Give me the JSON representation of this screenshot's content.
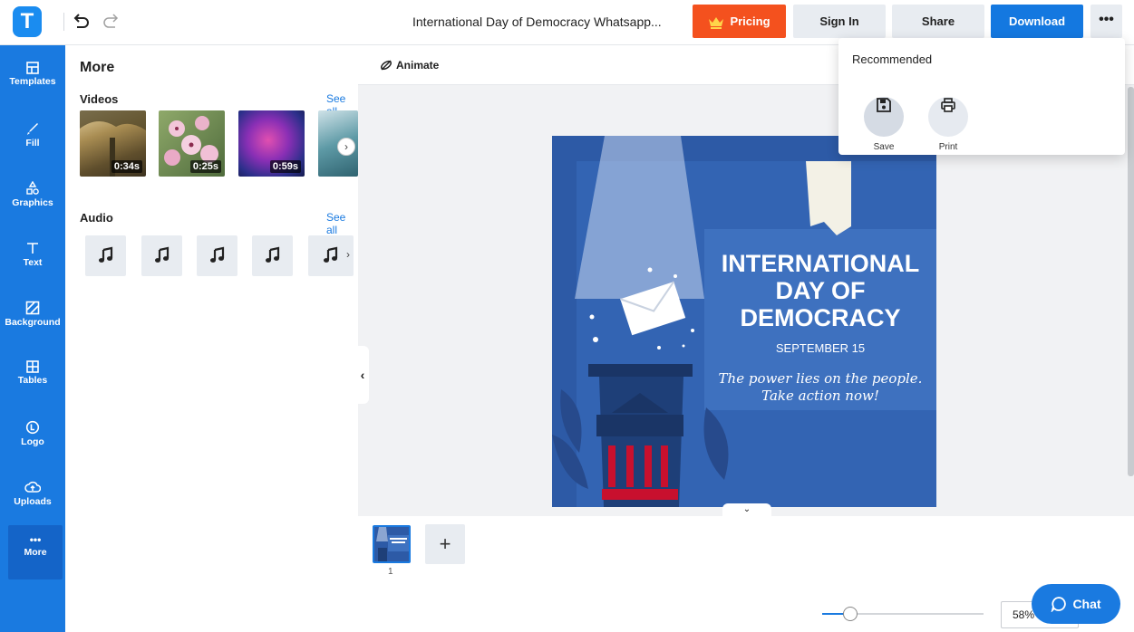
{
  "header": {
    "logo_letter": "T",
    "doc_title": "International Day of Democracy Whatsapp...",
    "pricing_label": "Pricing",
    "signin_label": "Sign In",
    "share_label": "Share",
    "download_label": "Download",
    "more_label": "•••"
  },
  "sidebar": {
    "items": [
      {
        "label": "Templates",
        "icon": "templates-icon"
      },
      {
        "label": "Fill",
        "icon": "brush-icon"
      },
      {
        "label": "Graphics",
        "icon": "shapes-icon"
      },
      {
        "label": "Text",
        "icon": "text-icon"
      },
      {
        "label": "Background",
        "icon": "background-icon"
      },
      {
        "label": "Tables",
        "icon": "table-icon"
      },
      {
        "label": "Logo",
        "icon": "logo-icon"
      },
      {
        "label": "Uploads",
        "icon": "upload-cloud-icon"
      },
      {
        "label": "More",
        "icon": "more-dots-icon"
      }
    ],
    "more_dots": "•••"
  },
  "panel": {
    "title": "More",
    "videos": {
      "title": "Videos",
      "see_all": "See all",
      "items": [
        {
          "duration": "0:34s"
        },
        {
          "duration": "0:25s"
        },
        {
          "duration": "0:59s"
        },
        {
          "duration": ""
        }
      ]
    },
    "audio": {
      "title": "Audio",
      "see_all": "See all",
      "count": 5
    }
  },
  "canvas": {
    "animate_label": "Animate",
    "design": {
      "headline_1": "INTERNATIONAL",
      "headline_2": "DAY OF",
      "headline_3": "DEMOCRACY",
      "date": "SEPTEMBER 15",
      "tagline_1": "The power lies on the people.",
      "tagline_2": "Take action now!"
    }
  },
  "pages": {
    "current": "1",
    "add_label": "+"
  },
  "zoom": {
    "value": "58%",
    "slider_fraction": 0.58
  },
  "chat": {
    "label": "Chat"
  },
  "download_menu": {
    "title": "Recommended",
    "items": [
      {
        "label": "Save",
        "icon": "save-icon"
      },
      {
        "label": "Print",
        "icon": "print-icon"
      }
    ]
  },
  "colors": {
    "accent": "#1a7ae0",
    "pricing": "#f4511e",
    "design_bg": "#2d5aa6"
  }
}
